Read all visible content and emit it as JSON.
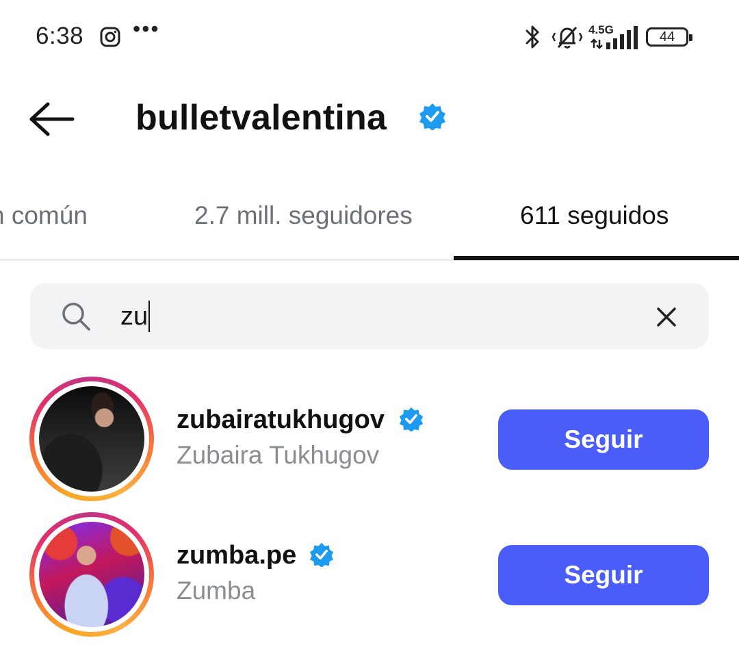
{
  "status_bar": {
    "time": "6:38",
    "more": "•••",
    "network": "4.5G",
    "battery": "44",
    "icons": [
      "instagram-icon",
      "bluetooth-icon",
      "muted-bell-icon",
      "signal-icon",
      "battery-icon"
    ]
  },
  "header": {
    "title": "bulletvalentina",
    "verified_color": "#1d9bf0"
  },
  "tabs": [
    {
      "label": "n común"
    },
    {
      "label": "2.7 mill. seguidores"
    },
    {
      "label": "611 seguidos",
      "active": true
    }
  ],
  "search": {
    "value": "zu"
  },
  "results": [
    {
      "username": "zubairatukhugov",
      "name": "Zubaira Tukhugov",
      "verified": true,
      "button": "Seguir"
    },
    {
      "username": "zumba.pe",
      "name": "Zumba",
      "verified": true,
      "button": "Seguir"
    }
  ],
  "colors": {
    "accent": "#4a5df9",
    "verified": "#1d9bf0",
    "secondary_text": "#8a8d91"
  }
}
